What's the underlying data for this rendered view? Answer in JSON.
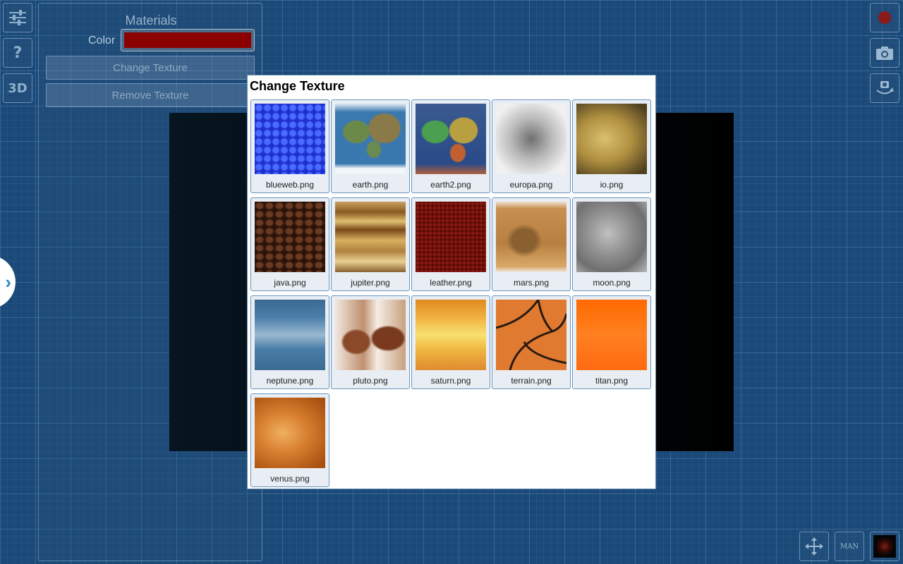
{
  "left_toolbar": {
    "help_label": "?",
    "view3d_label": "3D"
  },
  "materials_panel": {
    "title": "Materials",
    "color_label": "Color",
    "color_value": "#8b0000",
    "change_texture_label": "Change Texture",
    "remove_texture_label": "Remove Texture"
  },
  "dialog": {
    "title": "Change Texture",
    "textures": [
      {
        "name": "blueweb.png"
      },
      {
        "name": "earth.png"
      },
      {
        "name": "earth2.png"
      },
      {
        "name": "europa.png"
      },
      {
        "name": "io.png"
      },
      {
        "name": "java.png"
      },
      {
        "name": "jupiter.png"
      },
      {
        "name": "leather.png"
      },
      {
        "name": "mars.png"
      },
      {
        "name": "moon.png"
      },
      {
        "name": "neptune.png"
      },
      {
        "name": "pluto.png"
      },
      {
        "name": "saturn.png"
      },
      {
        "name": "terrain.png"
      },
      {
        "name": "titan.png"
      },
      {
        "name": "venus.png"
      }
    ]
  },
  "bottom_toolbar": {
    "mode_label": "MAN"
  },
  "colors": {
    "record": "#8b1a1a",
    "accent": "#2a8fc2"
  },
  "icons": [
    "sliders-icon",
    "help-icon",
    "3d-icon",
    "record-icon",
    "camera-icon",
    "rotate-camera-icon",
    "move-icon",
    "expand-arrow-icon"
  ]
}
